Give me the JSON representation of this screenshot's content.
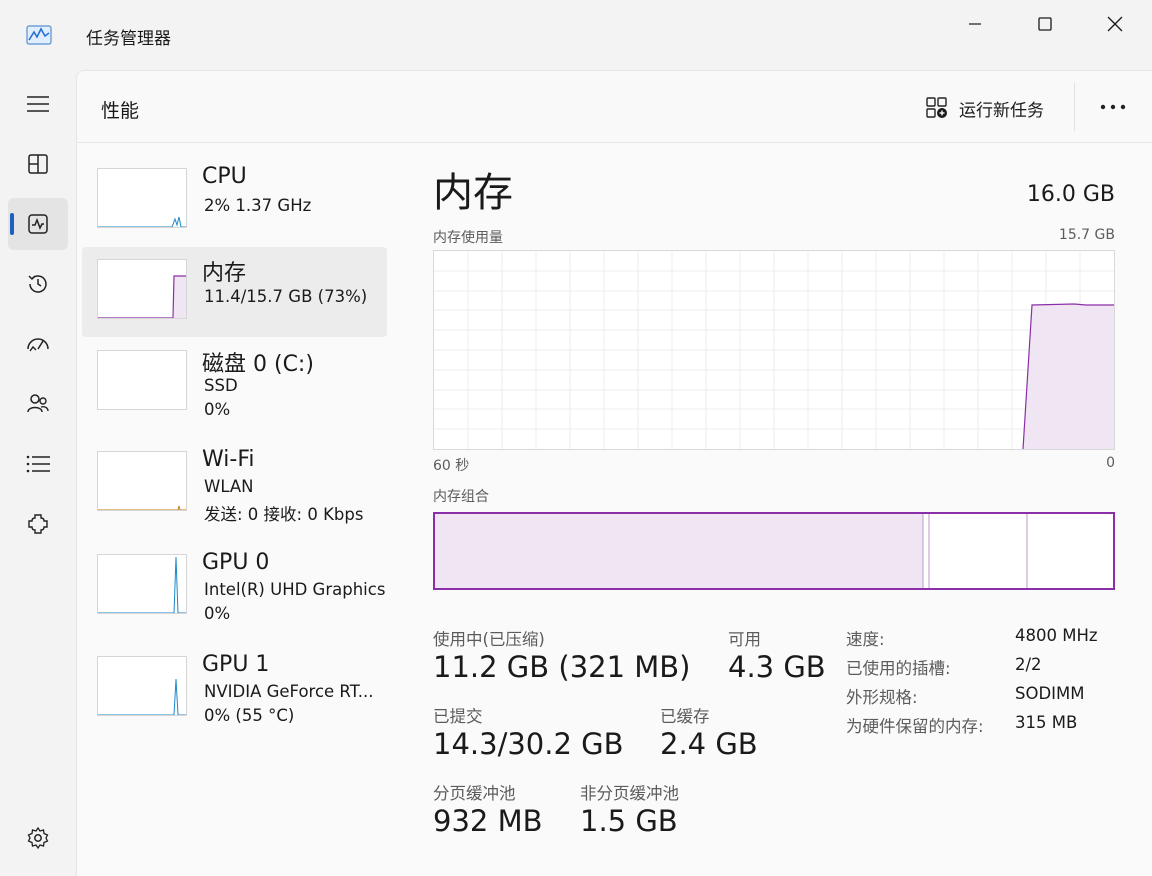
{
  "window": {
    "title": "任务管理器",
    "app_icon": "performance-chart-icon"
  },
  "nav": {
    "items": [
      {
        "icon": "hamburger-menu-icon"
      },
      {
        "icon": "processes-icon"
      },
      {
        "icon": "performance-icon",
        "active": true
      },
      {
        "icon": "app-history-icon"
      },
      {
        "icon": "startup-apps-icon"
      },
      {
        "icon": "users-icon"
      },
      {
        "icon": "details-icon"
      },
      {
        "icon": "services-icon"
      },
      {
        "icon": "settings-icon"
      }
    ]
  },
  "header": {
    "title": "性能",
    "run_task_label": "运行新任务"
  },
  "sidebar": {
    "items": [
      {
        "title": "CPU",
        "line1": "2%  1.37 GHz",
        "line2": ""
      },
      {
        "title": "内存",
        "line1": "11.4/15.7 GB (73%)",
        "line2": ""
      },
      {
        "title": "磁盘 0 (C:)",
        "line1": "SSD",
        "line2": "0%"
      },
      {
        "title": "Wi-Fi",
        "line1": "WLAN",
        "line2": "发送: 0  接收: 0 Kbps"
      },
      {
        "title": "GPU 0",
        "line1": "Intel(R) UHD Graphics",
        "line2": "0%"
      },
      {
        "title": "GPU 1",
        "line1": "NVIDIA GeForce RT...",
        "line2": "0%  (55 °C)"
      }
    ]
  },
  "detail": {
    "title": "内存",
    "total": "16.0 GB",
    "graph_label": "内存使用量",
    "graph_max": "15.7 GB",
    "axis_left": "60 秒",
    "axis_right": "0",
    "composition_label": "内存组合",
    "usage_fraction": 0.73,
    "stats": {
      "in_use_label": "使用中(已压缩)",
      "in_use_value": "11.2 GB (321 MB)",
      "available_label": "可用",
      "available_value": "4.3 GB",
      "committed_label": "已提交",
      "committed_value": "14.3/30.2 GB",
      "cached_label": "已缓存",
      "cached_value": "2.4 GB",
      "paged_pool_label": "分页缓冲池",
      "paged_pool_value": "932 MB",
      "nonpaged_pool_label": "非分页缓冲池",
      "nonpaged_pool_value": "1.5 GB"
    },
    "props": [
      {
        "key": "速度:",
        "value": "4800 MHz"
      },
      {
        "key": "已使用的插槽:",
        "value": "2/2"
      },
      {
        "key": "外形规格:",
        "value": "SODIMM"
      },
      {
        "key": "为硬件保留的内存:",
        "value": "315 MB"
      }
    ]
  },
  "colors": {
    "memory_accent": "#8b2fa8",
    "memory_fill": "#f0e6f3",
    "cpu_accent": "#1b88c9",
    "wifi_accent": "#c97a1b",
    "gpu_accent": "#1b88c9",
    "nav_indicator": "#1f5fbf"
  }
}
